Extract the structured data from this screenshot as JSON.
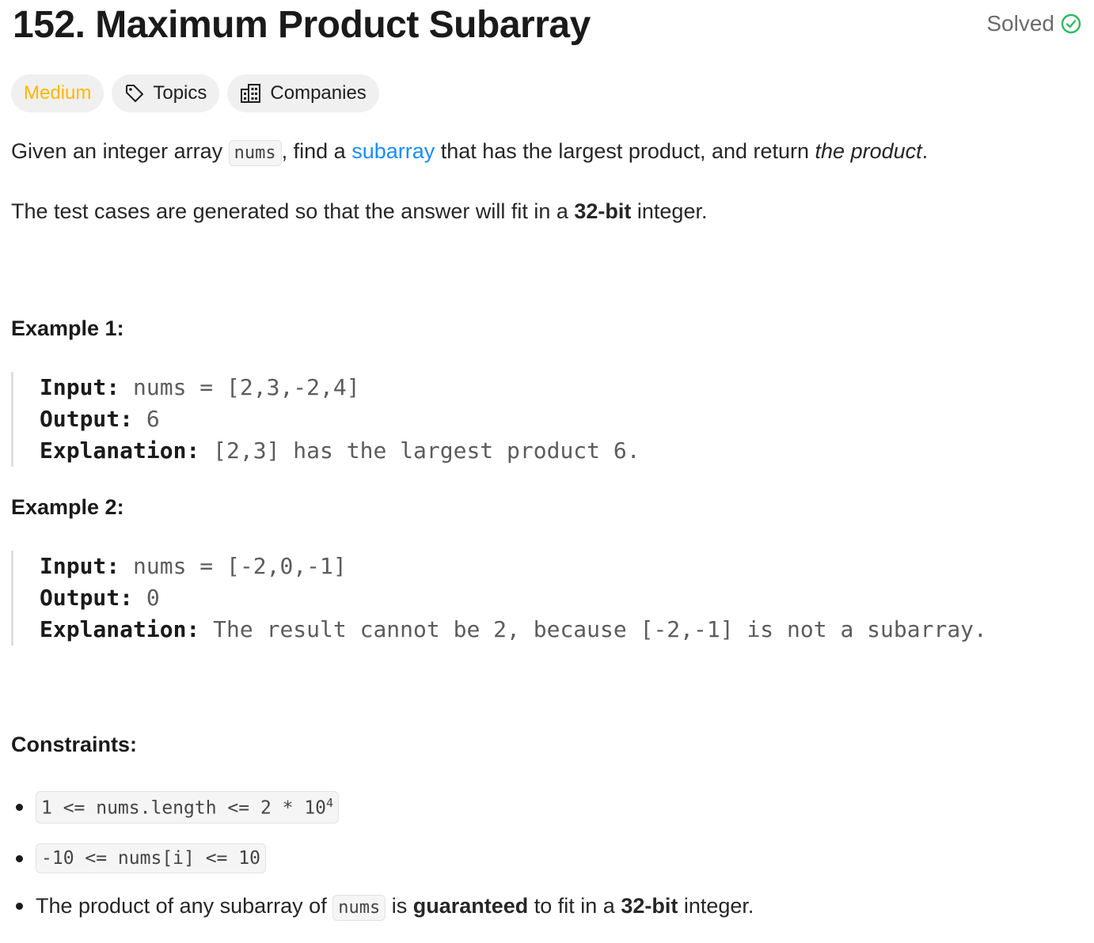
{
  "problem": {
    "number_title": "152. Maximum Product Subarray",
    "status": "Solved",
    "status_color": "#2cbb5d"
  },
  "tags": {
    "difficulty": "Medium",
    "difficulty_color": "#ffb800",
    "topics": "Topics",
    "companies": "Companies"
  },
  "description": {
    "p1_prefix": "Given an integer array ",
    "p1_code": "nums",
    "p1_mid": ", find a ",
    "p1_link": "subarray",
    "p1_after_link": " that has the largest product, and return ",
    "p1_italic": "the product",
    "p1_end": ".",
    "p2_prefix": "The test cases are generated so that the answer will fit in a ",
    "p2_bold": "32-bit",
    "p2_suffix": " integer."
  },
  "examples": [
    {
      "heading": "Example 1:",
      "input_label": "Input:",
      "input_value": " nums = [2,3,-2,4]",
      "output_label": "Output:",
      "output_value": " 6",
      "explanation_label": "Explanation:",
      "explanation_value": " [2,3] has the largest product 6."
    },
    {
      "heading": "Example 2:",
      "input_label": "Input:",
      "input_value": " nums = [-2,0,-1]",
      "output_label": "Output:",
      "output_value": " 0",
      "explanation_label": "Explanation:",
      "explanation_value": " The result cannot be 2, because [-2,-1] is not a subarray."
    }
  ],
  "constraints": {
    "heading": "Constraints:",
    "c1_code": "1 <= nums.length <= 2 * 10",
    "c1_sup": "4",
    "c2_code": "-10 <= nums[i] <= 10",
    "c3_prefix": "The product of any subarray of ",
    "c3_code": "nums",
    "c3_mid": " is ",
    "c3_bold1": "guaranteed",
    "c3_mid2": " to fit in a ",
    "c3_bold2": "32-bit",
    "c3_suffix": " integer."
  },
  "icons": {
    "solved": "check-circle-icon",
    "topics": "tag-icon",
    "companies": "building-icon"
  }
}
